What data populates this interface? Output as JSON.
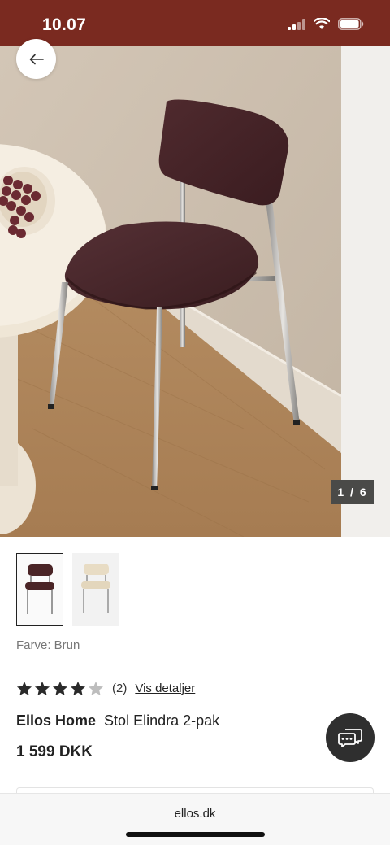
{
  "status": {
    "time": "10.07"
  },
  "gallery": {
    "counter": "1 / 6"
  },
  "product": {
    "color_label": "Farve: Brun",
    "rating": {
      "value": 4,
      "max": 5,
      "count": "(2)",
      "details_link": "Vis detaljer"
    },
    "brand": "Ellos Home",
    "name": "Stol Elindra 2-pak",
    "price": "1 599 DKK"
  },
  "browser": {
    "url": "ellos.dk"
  },
  "icons": {
    "back": "arrow-left-icon",
    "chat": "chat-icon",
    "signal": "signal-icon",
    "wifi": "wifi-icon",
    "battery": "battery-icon"
  },
  "colors": {
    "status_bar": "#7a2a20",
    "chair": "#4a2426",
    "star": "#2a2a2a"
  }
}
